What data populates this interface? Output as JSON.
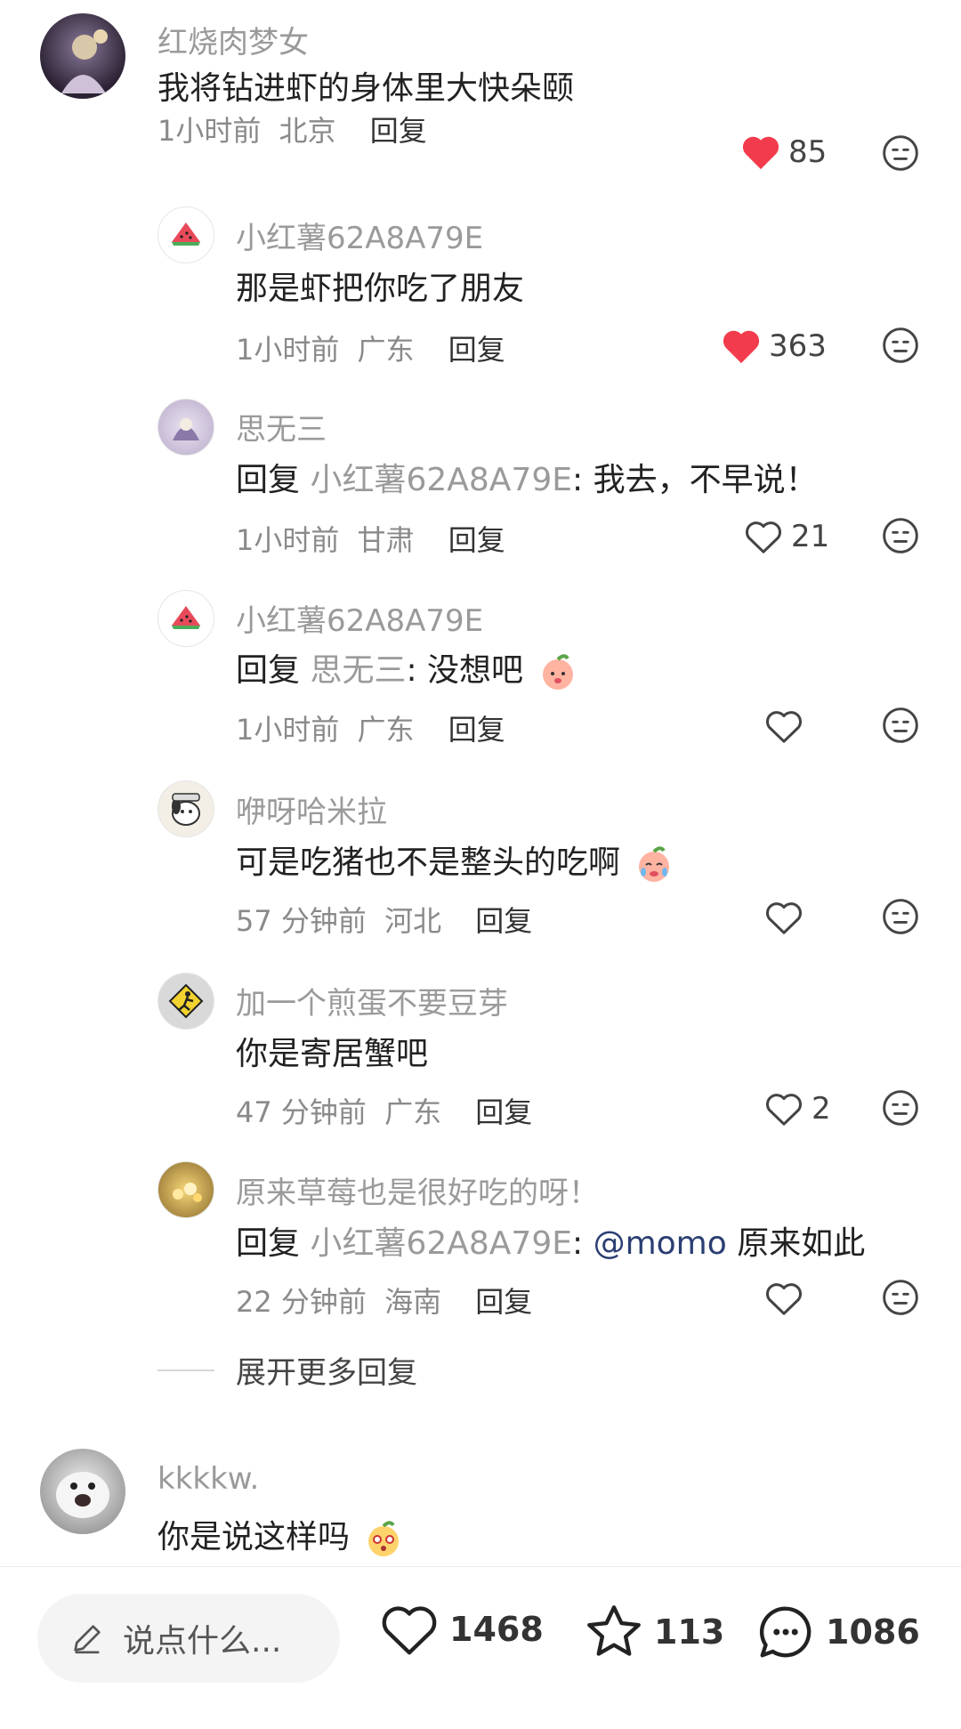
{
  "comments": [
    {
      "username": "红烧肉梦女",
      "text": "我将钻进虾的身体里大快朵颐",
      "time": "1小时前",
      "location": "北京",
      "reply_label": "回复",
      "likes": "85",
      "liked": true
    }
  ],
  "replies": [
    {
      "username": "小红薯62A8A79E",
      "text": "那是虾把你吃了朋友",
      "time": "1小时前",
      "location": "广东",
      "reply_label": "回复",
      "likes": "363",
      "liked": true
    },
    {
      "username": "思无三",
      "reply_prefix": "回复",
      "reply_target": "小红薯62A8A79E",
      "text": ": 我去，不早说！",
      "time": "1小时前",
      "location": "甘肃",
      "reply_label": "回复",
      "likes": "21",
      "liked": false
    },
    {
      "username": "小红薯62A8A79E",
      "reply_prefix": "回复",
      "reply_target": "思无三",
      "text": ": 没想吧",
      "time": "1小时前",
      "location": "广东",
      "reply_label": "回复",
      "likes": "",
      "liked": false
    },
    {
      "username": "咿呀哈米拉",
      "text": "可是吃猪也不是整头的吃啊",
      "time": "57 分钟前",
      "location": "河北",
      "reply_label": "回复",
      "likes": "",
      "liked": false
    },
    {
      "username": "加一个煎蛋不要豆芽",
      "text": "你是寄居蟹吧",
      "time": "47 分钟前",
      "location": "广东",
      "reply_label": "回复",
      "likes": "2",
      "liked": false
    },
    {
      "username": "原来草莓也是很好吃的呀！",
      "reply_prefix": "回复",
      "reply_target": "小红薯62A8A79E",
      "mention": "@momo",
      "text": " 原来如此",
      "time": "22 分钟前",
      "location": "海南",
      "reply_label": "回复",
      "likes": "",
      "liked": false
    }
  ],
  "expand_more": "展开更多回复",
  "second_comment": {
    "username": "kkkkw.",
    "text": "你是说这样吗"
  },
  "bottom_bar": {
    "input_placeholder": "说点什么...",
    "likes": "1468",
    "stars": "113",
    "comments": "1086"
  },
  "colors": {
    "like_red": "#f23b4c",
    "username_gray": "#9a9a9a",
    "mention_blue": "#2a3e72"
  }
}
